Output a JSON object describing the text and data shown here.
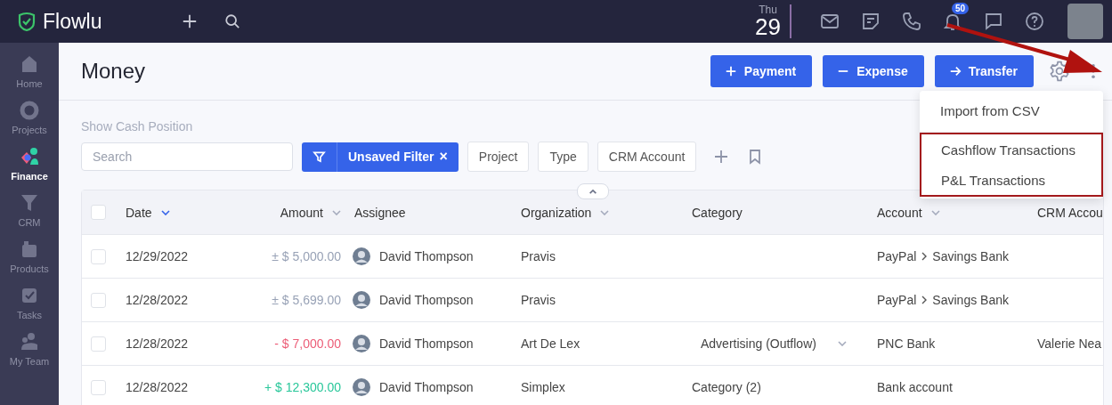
{
  "app": {
    "name": "Flowlu"
  },
  "topbar": {
    "day": "Thu",
    "date": "29",
    "notifications": "50"
  },
  "sidebar": {
    "items": [
      {
        "label": "Home",
        "selected": false
      },
      {
        "label": "Projects",
        "selected": false
      },
      {
        "label": "Finance",
        "selected": true
      },
      {
        "label": "CRM",
        "selected": false
      },
      {
        "label": "Products",
        "selected": false
      },
      {
        "label": "Tasks",
        "selected": false
      },
      {
        "label": "My Team",
        "selected": false
      }
    ]
  },
  "page": {
    "title": "Money",
    "buttons": [
      {
        "label": "Payment",
        "kind": "plus"
      },
      {
        "label": "Expense",
        "kind": "minus"
      },
      {
        "label": "Transfer",
        "kind": "arrow"
      }
    ]
  },
  "menu": {
    "items": [
      "Import from CSV"
    ],
    "highlighted_items": [
      "Cashflow Transactions",
      "P&L Transactions"
    ]
  },
  "filters": {
    "cash_position_link": "Show Cash Position",
    "search": {
      "placeholder": "Search"
    },
    "active_filter": "Unsaved Filter",
    "remove": "×",
    "chips": [
      "Project",
      "Type",
      "CRM Account"
    ]
  },
  "table": {
    "all_checked": false,
    "columns": [
      {
        "label": "Date",
        "sortable": true,
        "sorted": true
      },
      {
        "label": "Amount",
        "sortable": true,
        "sorted": false
      },
      {
        "label": "Assignee",
        "sortable": false
      },
      {
        "label": "Organization",
        "sortable": true,
        "sorted": false
      },
      {
        "label": "Category",
        "sortable": false
      },
      {
        "label": "Account",
        "sortable": true,
        "sorted": false
      },
      {
        "label": "CRM Accou",
        "sortable": false
      }
    ],
    "rows": [
      {
        "checked": false,
        "date": "12/29/2022",
        "amount": "± $ 5,000.00",
        "kind": "transfer",
        "assignee": "David Thompson",
        "organization": "Pravis",
        "account": [
          "PayPal",
          "Savings Bank"
        ]
      },
      {
        "checked": false,
        "date": "12/28/2022",
        "amount": "± $ 5,699.00",
        "kind": "transfer",
        "assignee": "David Thompson",
        "organization": "Pravis",
        "account": [
          "PayPal",
          "Savings Bank"
        ]
      },
      {
        "checked": false,
        "date": "12/28/2022",
        "amount": "- $ 7,000.00",
        "kind": "expense",
        "assignee": "David Thompson",
        "organization": "Art De Lex",
        "category": {
          "text": "Advertising (Outflow)",
          "dropdown": true
        },
        "account": [
          "PNC Bank"
        ],
        "crm_account": "Valerie Nea"
      },
      {
        "checked": false,
        "date": "12/28/2022",
        "amount": "+ $ 12,300.00",
        "kind": "income",
        "assignee": "David Thompson",
        "organization": "Simplex",
        "category": {
          "text": "Category (2)",
          "dropdown": false
        },
        "account": [
          "Bank account"
        ]
      }
    ]
  }
}
